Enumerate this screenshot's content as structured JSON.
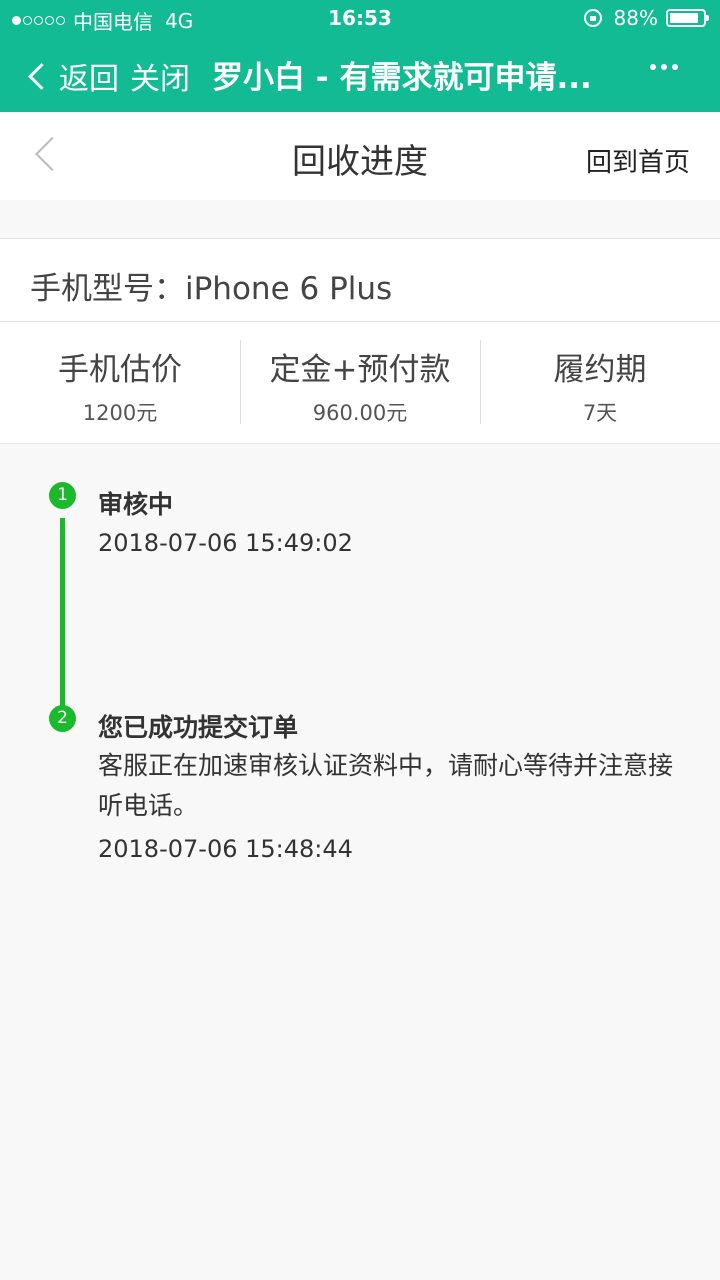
{
  "status_bar": {
    "carrier": "中国电信",
    "network": "4G",
    "time": "16:53",
    "battery": "88%",
    "battery_level": 0.88
  },
  "nav": {
    "back_label": "返回",
    "close_label": "关闭",
    "title": "罗小白 - 有需求就可申请..."
  },
  "header": {
    "title": "回收进度",
    "home_label": "回到首页"
  },
  "model": {
    "text": "手机型号：iPhone 6 Plus"
  },
  "stats": [
    {
      "label": "手机估价",
      "value": "1200元"
    },
    {
      "label": "定金+预付款",
      "value": "960.00元"
    },
    {
      "label": "履约期",
      "value": "7天"
    }
  ],
  "timeline": [
    {
      "step": "1",
      "title": "审核中",
      "desc": "",
      "time": "2018-07-06 15:49:02"
    },
    {
      "step": "2",
      "title": "您已成功提交订单",
      "desc": "客服正在加速审核认证资料中，请耐心等待并注意接听电话。",
      "time": "2018-07-06 15:48:44"
    }
  ],
  "colors": {
    "brand": "#12bb94",
    "timeline": "#1aba2c"
  }
}
